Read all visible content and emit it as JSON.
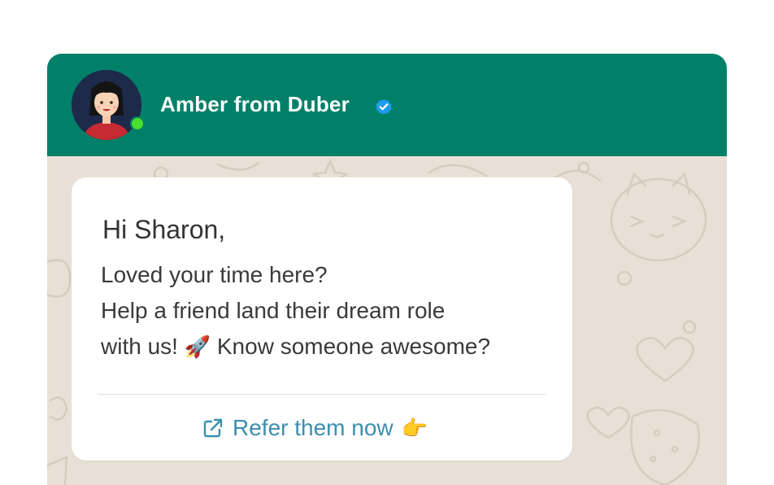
{
  "header": {
    "contact_name": "Amber from Duber",
    "avatar_label": "Amber",
    "verified_icon": "verified-badge-icon",
    "online_status_color": "#4ade2f",
    "header_color": "#008069"
  },
  "message": {
    "greeting": "Hi Sharon,",
    "line1": "Loved your time here?",
    "line2": "Help a friend land their dream role",
    "line3_text": "with us!",
    "line3_emoji": "🚀",
    "line3_rest": "Know someone awesome?"
  },
  "cta": {
    "icon": "external-link-icon",
    "label": "Refer them now",
    "emoji": "👉",
    "color": "#3a8fb0"
  }
}
